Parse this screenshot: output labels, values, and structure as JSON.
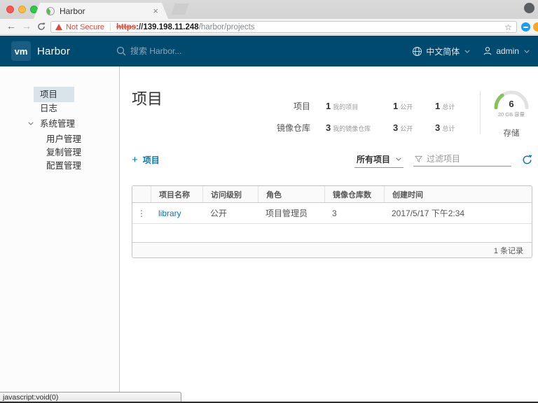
{
  "colors": {
    "header_bg": "#004a70",
    "logo_bg": "#1b5d82",
    "link": "#0079b8",
    "gauge_green": "#87c15c",
    "warning_red": "#dc4b3e",
    "nav_active_bg": "#d8e3ea"
  },
  "browser": {
    "tab_title": "Harbor",
    "close_label": "×",
    "url": {
      "warning": "Not Secure",
      "protocol": "https",
      "separator": "://",
      "domain": "139.198.11.248",
      "path": "/harbor/projects"
    },
    "status_text": "javascript:void(0)"
  },
  "header": {
    "logo_text": "vm",
    "brand": "Harbor",
    "search_placeholder": "搜索 Harbor...",
    "language": "中文简体",
    "user": "admin"
  },
  "sidebar": {
    "items": [
      {
        "label": "项目"
      },
      {
        "label": "日志"
      },
      {
        "label": "系统管理"
      },
      {
        "label": "用户管理"
      },
      {
        "label": "复制管理"
      },
      {
        "label": "配置管理"
      }
    ]
  },
  "main": {
    "title": "项目",
    "stats": {
      "rows": [
        {
          "label": "项目",
          "cells": [
            {
              "value": "1",
              "unit": "我的项目"
            },
            {
              "value": "1",
              "unit": "公开"
            },
            {
              "value": "1",
              "unit": "总计"
            }
          ]
        },
        {
          "label": "镜像仓库",
          "cells": [
            {
              "value": "3",
              "unit": "我的镜像仓库"
            },
            {
              "value": "3",
              "unit": "公开"
            },
            {
              "value": "3",
              "unit": "总计"
            }
          ]
        }
      ]
    },
    "storage": {
      "used": "6",
      "capacity": "20 GB 容量",
      "label": "存储",
      "percent": 30
    },
    "toolbar": {
      "plus": "+",
      "new_project": "项目",
      "filter_selected": "所有项目",
      "filter_placeholder": "过滤项目"
    },
    "table": {
      "columns": [
        "项目名称",
        "访问级别",
        "角色",
        "镜像仓库数",
        "创建时间"
      ],
      "rows": [
        {
          "name": "library",
          "access": "公开",
          "role": "项目管理员",
          "repos": "3",
          "created": "2017/5/17 下午2:34"
        }
      ],
      "footer": "1 条记录"
    }
  }
}
